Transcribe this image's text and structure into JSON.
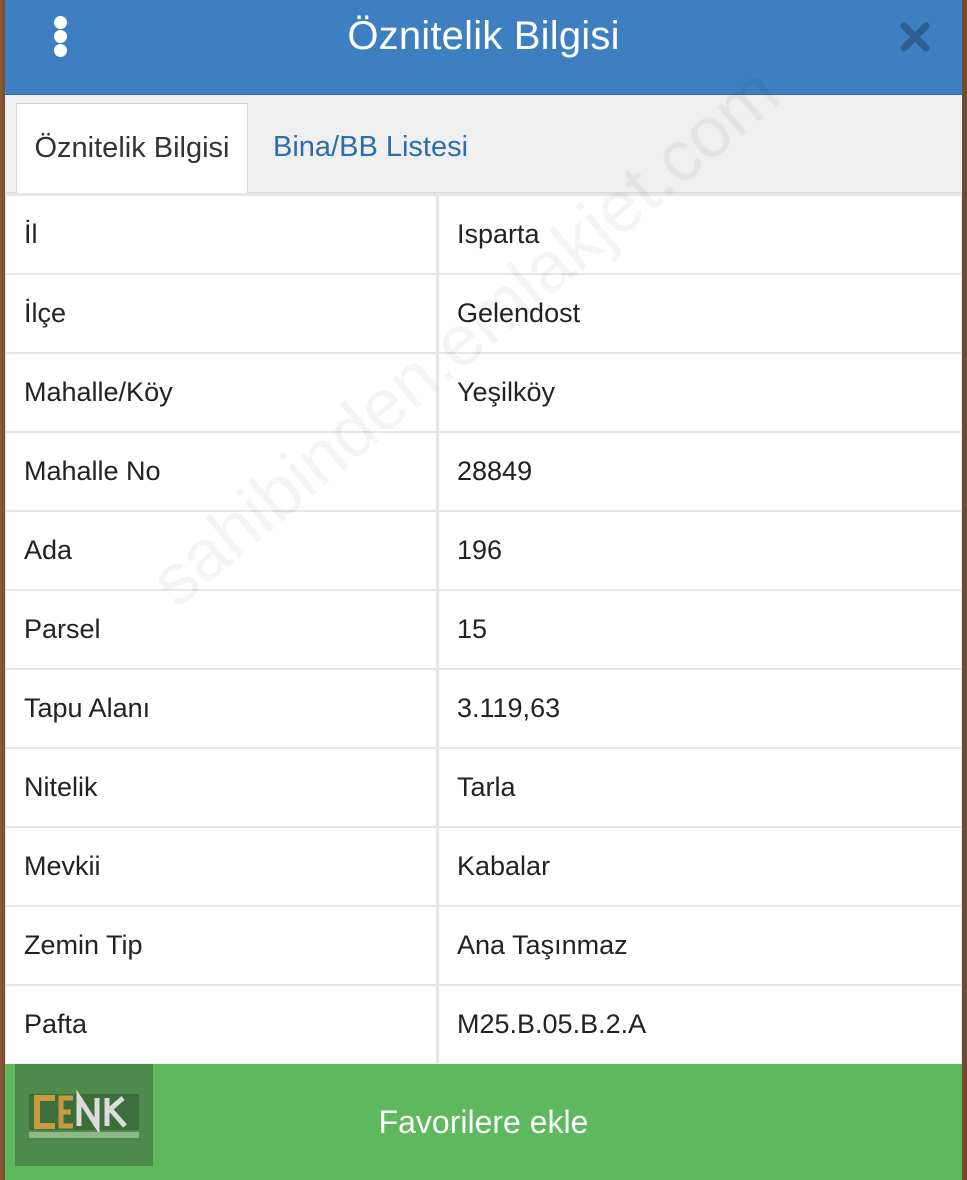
{
  "header": {
    "title": "Öznitelik Bilgisi"
  },
  "tabs": [
    {
      "label": "Öznitelik Bilgisi",
      "active": true
    },
    {
      "label": "Bina/BB Listesi",
      "active": false
    }
  ],
  "rows": [
    {
      "label": "İl",
      "value": "Isparta"
    },
    {
      "label": "İlçe",
      "value": "Gelendost"
    },
    {
      "label": "Mahalle/Köy",
      "value": "Yeşilköy"
    },
    {
      "label": "Mahalle No",
      "value": "28849"
    },
    {
      "label": "Ada",
      "value": "196"
    },
    {
      "label": "Parsel",
      "value": "15"
    },
    {
      "label": "Tapu Alanı",
      "value": "3.119,63"
    },
    {
      "label": "Nitelik",
      "value": "Tarla"
    },
    {
      "label": "Mevkii",
      "value": "Kabalar"
    },
    {
      "label": "Zemin Tip",
      "value": "Ana Taşınmaz"
    },
    {
      "label": "Pafta",
      "value": "M25.B.05.B.2.A"
    }
  ],
  "footer": {
    "button_label": "Favorilere ekle"
  },
  "watermark": {
    "text": "sahibinden.emlakjet.com"
  },
  "logo": {
    "text": "CENK",
    "subtext": "EMLAK GAYRİMENKUL DANIŞMANLIK"
  },
  "colors": {
    "header": "#3d7fc0",
    "tab_link": "#2c6eab",
    "footer_button": "#5db85e"
  },
  "icons": {
    "menu": "vertical-dots-icon",
    "close": "close-icon"
  }
}
